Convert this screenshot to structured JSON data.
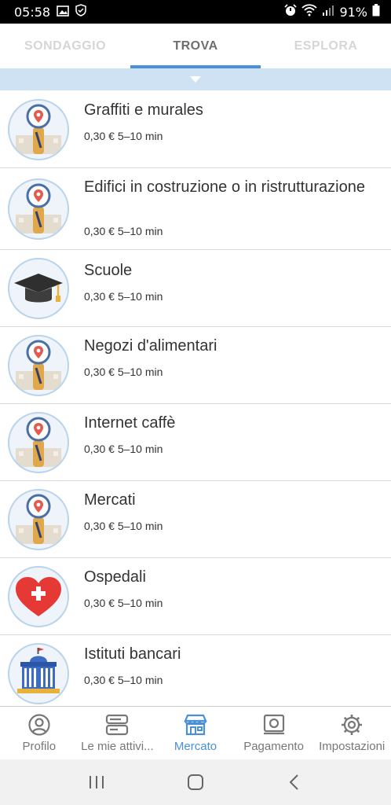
{
  "status_bar": {
    "time": "05:58",
    "battery": "91%",
    "icons": [
      "image-icon",
      "shield-icon",
      "alarm-icon",
      "wifi-icon",
      "signal-icon",
      "battery-icon"
    ]
  },
  "tabs": [
    {
      "label": "SONDAGGIO",
      "active": false
    },
    {
      "label": "TROVA",
      "active": true
    },
    {
      "label": "ESPLORA",
      "active": false
    }
  ],
  "colors": {
    "accent": "#4a90d9",
    "filter_bar": "#cfe2f4",
    "heart": "#e53935",
    "cap": "#333333"
  },
  "tasks": [
    {
      "title": "Graffiti e murales",
      "price": "0,30 €",
      "duration": "5–10 min",
      "icon": "map-pin-icon"
    },
    {
      "title": "Edifici in costruzione o in ristrutturazione",
      "price": "0,30 €",
      "duration": "5–10 min",
      "icon": "map-pin-icon"
    },
    {
      "title": "Scuole",
      "price": "0,30 €",
      "duration": "5–10 min",
      "icon": "graduation-cap-icon"
    },
    {
      "title": "Negozi d'alimentari",
      "price": "0,30 €",
      "duration": "5–10 min",
      "icon": "map-pin-icon"
    },
    {
      "title": "Internet caffè",
      "price": "0,30 €",
      "duration": "5–10 min",
      "icon": "map-pin-icon"
    },
    {
      "title": "Mercati",
      "price": "0,30 €",
      "duration": "5–10 min",
      "icon": "map-pin-icon"
    },
    {
      "title": "Ospedali",
      "price": "0,30 €",
      "duration": "5–10 min",
      "icon": "heart-cross-icon"
    },
    {
      "title": "Istituti bancari",
      "price": "0,30 €",
      "duration": "5–10 min",
      "icon": "bank-building-icon"
    }
  ],
  "bottom_nav": [
    {
      "label": "Profilo",
      "icon": "profile-icon",
      "active": false
    },
    {
      "label": "Le mie attivi...",
      "icon": "activities-icon",
      "active": false
    },
    {
      "label": "Mercato",
      "icon": "store-icon",
      "active": true
    },
    {
      "label": "Pagamento",
      "icon": "payment-icon",
      "active": false
    },
    {
      "label": "Impostazioni",
      "icon": "settings-icon",
      "active": false
    }
  ],
  "system_nav": [
    "recent-apps-icon",
    "home-icon",
    "back-icon"
  ]
}
